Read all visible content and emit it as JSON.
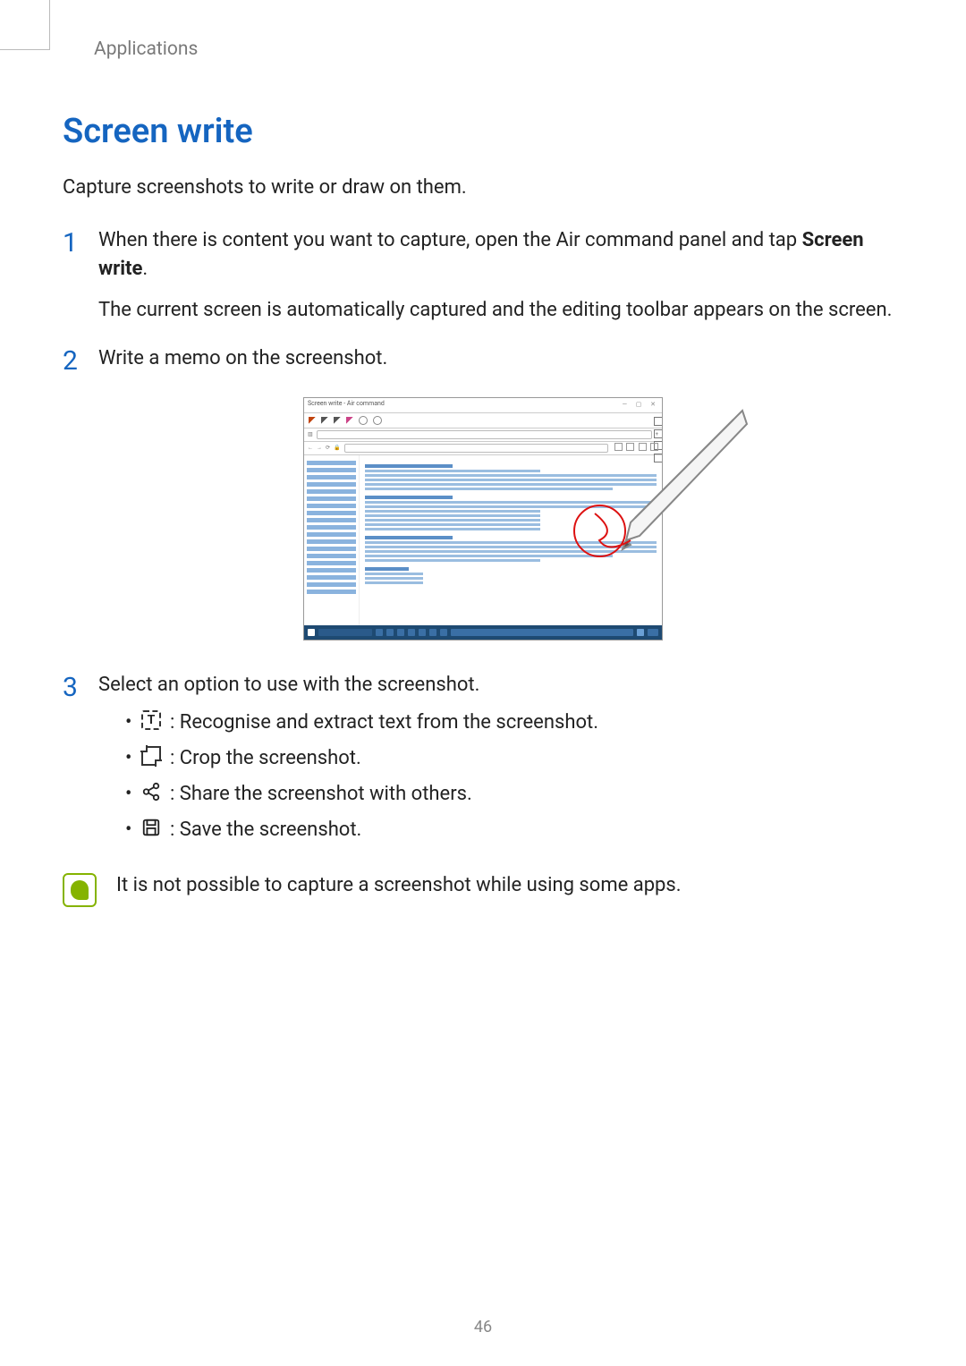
{
  "header": {
    "section_label": "Applications"
  },
  "title": "Screen write",
  "intro": "Capture screenshots to write or draw on them.",
  "steps": {
    "s1": {
      "num": "1",
      "text_a": "When there is content you want to capture, open the Air command panel and tap ",
      "bold": "Screen write",
      "period": ".",
      "sub": "The current screen is automatically captured and the editing toolbar appears on the screen."
    },
    "s2": {
      "num": "2",
      "text": "Write a memo on the screenshot."
    },
    "s3": {
      "num": "3",
      "text": "Select an option to use with the screenshot.",
      "b1": ": Recognise and extract text from the screenshot.",
      "b2": ": Crop the screenshot.",
      "b3": ": Share the screenshot with others.",
      "b4": ": Save the screenshot."
    }
  },
  "note": "It is not possible to capture a screenshot while using some apps.",
  "page_number": "46",
  "mock": {
    "title": "Screen write - Air command"
  }
}
